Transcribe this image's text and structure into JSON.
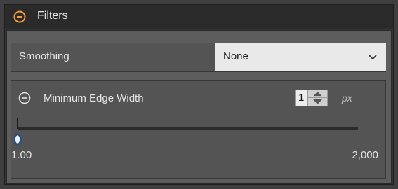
{
  "filters": {
    "title": "Filters",
    "accent_color": "#f39c3b",
    "collapse_icon": "minus-circle-icon"
  },
  "smoothing": {
    "label": "Smoothing",
    "value": "None",
    "dropdown_icon": "chevron-down-icon"
  },
  "edge_width": {
    "title": "Minimum Edge Width",
    "collapse_icon": "minus-circle-icon",
    "spinner_value": "1",
    "unit": "px",
    "slider_min_label": "1.00",
    "slider_max_label": "2,000",
    "slider_fraction": 0.0
  }
}
